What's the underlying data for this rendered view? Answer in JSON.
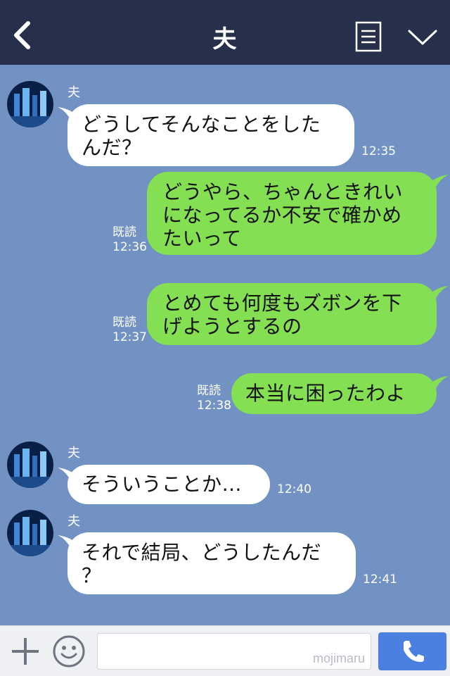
{
  "header": {
    "title": "夫",
    "back_icon": "chevron-left-icon",
    "menu_icon": "list-icon",
    "dropdown_icon": "chevron-down-icon"
  },
  "messages": [
    {
      "sender": "夫",
      "side": "in",
      "lines": [
        "どうしてそんなことをした",
        "んだ？"
      ],
      "time": "12:35"
    },
    {
      "side": "out",
      "lines": [
        "どうやら、ちゃんときれい",
        "になってるか不安で確かめ",
        "たいって"
      ],
      "read": "既読",
      "time": "12:36"
    },
    {
      "side": "out",
      "lines": [
        "とめても何度もズボンを下",
        "げようとするの"
      ],
      "read": "既読",
      "time": "12:37"
    },
    {
      "side": "out",
      "lines": [
        "本当に困ったわよ"
      ],
      "read": "既読",
      "time": "12:38"
    },
    {
      "sender": "夫",
      "side": "in",
      "lines": [
        "そういうことか…"
      ],
      "time": "12:40"
    },
    {
      "sender": "夫",
      "side": "in",
      "lines": [
        "それで結局、どうしたんだ",
        "？"
      ],
      "time": "12:41"
    }
  ],
  "footer": {
    "plus_icon": "plus-icon",
    "emoji_icon": "smiley-icon",
    "input_value": "",
    "watermark": "mojimaru",
    "call_icon": "phone-icon"
  },
  "colors": {
    "header": "#27304a",
    "background": "#7292c3",
    "incoming_bubble": "#ffffff",
    "outgoing_bubble": "#84df53",
    "call_button": "#4a80e0"
  }
}
